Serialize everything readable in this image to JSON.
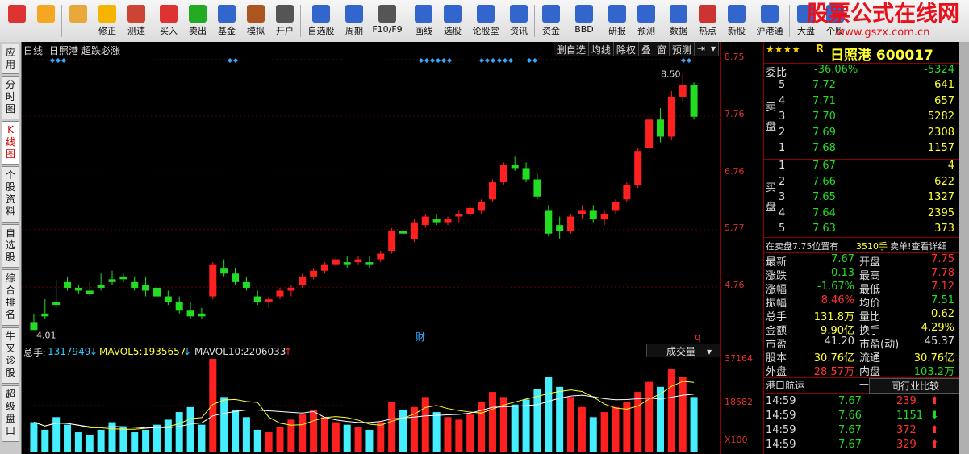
{
  "toolbar": {
    "buttons": [
      {
        "label": "",
        "icon": "menu-grid-icon"
      },
      {
        "label": "",
        "icon": "back-arrow-icon"
      },
      {
        "label": "",
        "icon": "up-down-icon"
      },
      {
        "label": "修正",
        "icon": "fix-icon"
      },
      {
        "label": "测速",
        "icon": "speed-icon"
      },
      {
        "label": "买入",
        "icon": "buy-icon"
      },
      {
        "label": "卖出",
        "icon": "sell-icon"
      },
      {
        "label": "基金",
        "icon": "fund-icon"
      },
      {
        "label": "模拟",
        "icon": "hammer-icon"
      },
      {
        "label": "开户",
        "icon": "lock-icon"
      },
      {
        "label": "自选股",
        "icon": "star-icon"
      },
      {
        "label": "周期",
        "icon": "clock-icon"
      },
      {
        "label": "F10/F9",
        "icon": "f10-icon"
      },
      {
        "label": "画线",
        "icon": "pen-icon"
      },
      {
        "label": "选股",
        "icon": "select-icon"
      },
      {
        "label": "论股堂",
        "icon": "forum-icon"
      },
      {
        "label": "资讯",
        "icon": "news-icon"
      },
      {
        "label": "资金",
        "icon": "money-icon"
      },
      {
        "label": "BBD",
        "icon": "bbd-icon"
      },
      {
        "label": "研报",
        "icon": "report-icon"
      },
      {
        "label": "预测",
        "icon": "forecast-icon"
      },
      {
        "label": "数据",
        "icon": "pe-icon"
      },
      {
        "label": "热点",
        "icon": "hot-icon"
      },
      {
        "label": "新股",
        "icon": "ipo-icon"
      },
      {
        "label": "沪港通",
        "icon": "hk-icon"
      },
      {
        "label": "大盘",
        "icon": "market-icon"
      },
      {
        "label": "个股",
        "icon": "stock-icon"
      }
    ],
    "brand_title": "股票公式在线网",
    "brand_url": "www.gszx.com.cn"
  },
  "sidetabs": [
    "应用",
    "分时图",
    "K线图",
    "个股资料",
    "自选股",
    "综合排名",
    "牛叉诊股",
    "超级盘口"
  ],
  "chart": {
    "period": "日线",
    "stock_name": "日照港",
    "indicator": "超跌必涨",
    "tools": [
      "删自选",
      "均线",
      "除权",
      "叠",
      "窗",
      "预测"
    ],
    "price_high_label": "8.50",
    "price_low_label": "4.01",
    "marker_cai": "财",
    "marker_q": "q",
    "price_scale": [
      "8.75",
      "7.76",
      "6.76",
      "5.77",
      "4.76"
    ],
    "vol_scale": [
      "37164",
      "18582",
      "X100"
    ],
    "vol_total_label": "总手:",
    "vol_total": "1317949",
    "mavol5_label": "MAVOL5:",
    "mavol5": "1935657",
    "mavol10_label": "MAVOL10:",
    "mavol10": "2206033",
    "vol_dropdown": "成交量"
  },
  "chart_data": {
    "type": "candlestick",
    "y_range": [
      4.0,
      8.75
    ],
    "candles": [
      [
        4.15,
        4.3,
        4.05,
        4.01
      ],
      [
        4.3,
        4.55,
        4.2,
        4.25
      ],
      [
        4.5,
        4.9,
        4.4,
        4.45
      ],
      [
        4.85,
        4.95,
        4.7,
        4.75
      ],
      [
        4.75,
        4.8,
        4.65,
        4.7
      ],
      [
        4.7,
        4.85,
        4.6,
        4.65
      ],
      [
        4.8,
        5.0,
        4.7,
        4.75
      ],
      [
        4.9,
        5.05,
        4.8,
        4.85
      ],
      [
        4.95,
        5.0,
        4.85,
        4.9
      ],
      [
        4.85,
        4.95,
        4.7,
        4.75
      ],
      [
        4.8,
        4.95,
        4.6,
        4.7
      ],
      [
        4.75,
        4.9,
        4.55,
        4.6
      ],
      [
        4.6,
        4.7,
        4.45,
        4.5
      ],
      [
        4.5,
        4.6,
        4.3,
        4.35
      ],
      [
        4.35,
        4.5,
        4.2,
        4.25
      ],
      [
        4.3,
        4.4,
        4.2,
        4.25
      ],
      [
        4.6,
        5.2,
        4.55,
        5.15
      ],
      [
        5.1,
        5.25,
        4.95,
        5.0
      ],
      [
        5.0,
        5.1,
        4.8,
        4.85
      ],
      [
        4.85,
        4.95,
        4.7,
        4.75
      ],
      [
        4.6,
        4.7,
        4.45,
        4.5
      ],
      [
        4.5,
        4.6,
        4.4,
        4.55
      ],
      [
        4.6,
        4.75,
        4.55,
        4.7
      ],
      [
        4.7,
        4.8,
        4.6,
        4.75
      ],
      [
        4.8,
        5.0,
        4.75,
        4.95
      ],
      [
        4.95,
        5.1,
        4.9,
        5.05
      ],
      [
        5.05,
        5.2,
        5.0,
        5.15
      ],
      [
        5.15,
        5.3,
        5.1,
        5.25
      ],
      [
        5.2,
        5.3,
        5.1,
        5.15
      ],
      [
        5.2,
        5.3,
        5.15,
        5.25
      ],
      [
        5.2,
        5.3,
        5.1,
        5.15
      ],
      [
        5.25,
        5.4,
        5.2,
        5.35
      ],
      [
        5.4,
        5.8,
        5.35,
        5.75
      ],
      [
        5.75,
        6.0,
        5.6,
        5.7
      ],
      [
        5.6,
        5.95,
        5.55,
        5.9
      ],
      [
        5.85,
        6.05,
        5.8,
        6.0
      ],
      [
        5.95,
        6.05,
        5.85,
        5.9
      ],
      [
        5.9,
        6.0,
        5.85,
        5.95
      ],
      [
        6.0,
        6.1,
        5.9,
        6.05
      ],
      [
        6.05,
        6.2,
        6.0,
        6.15
      ],
      [
        6.1,
        6.3,
        6.05,
        6.25
      ],
      [
        6.3,
        6.65,
        6.25,
        6.6
      ],
      [
        6.6,
        6.95,
        6.55,
        6.9
      ],
      [
        6.9,
        7.05,
        6.8,
        6.85
      ],
      [
        6.85,
        6.95,
        6.6,
        6.65
      ],
      [
        6.65,
        6.75,
        6.3,
        6.35
      ],
      [
        6.1,
        6.2,
        5.65,
        5.7
      ],
      [
        5.85,
        6.0,
        5.6,
        5.75
      ],
      [
        5.75,
        6.05,
        5.7,
        6.0
      ],
      [
        6.05,
        6.2,
        5.95,
        6.1
      ],
      [
        6.1,
        6.2,
        5.9,
        5.95
      ],
      [
        5.95,
        6.1,
        5.85,
        6.05
      ],
      [
        6.1,
        6.3,
        6.05,
        6.25
      ],
      [
        6.3,
        6.6,
        6.25,
        6.55
      ],
      [
        6.55,
        7.2,
        6.5,
        7.15
      ],
      [
        7.2,
        7.8,
        7.1,
        7.7
      ],
      [
        7.7,
        7.9,
        7.3,
        7.4
      ],
      [
        7.4,
        8.2,
        7.35,
        8.1
      ],
      [
        8.1,
        8.5,
        8.0,
        8.3
      ],
      [
        8.3,
        8.35,
        7.7,
        7.75
      ]
    ],
    "volume_range": [
      0,
      37164
    ],
    "volumes": [
      12000,
      9000,
      14000,
      11000,
      8000,
      7000,
      9000,
      12000,
      10000,
      8000,
      9000,
      11000,
      13000,
      16000,
      18000,
      11000,
      37164,
      22000,
      17000,
      14000,
      9000,
      8000,
      10000,
      13000,
      15000,
      17000,
      14000,
      12000,
      11000,
      10000,
      9000,
      12000,
      20000,
      17000,
      18000,
      22000,
      16000,
      14000,
      13000,
      15000,
      20000,
      24000,
      22000,
      19000,
      21000,
      25000,
      30000,
      26000,
      22000,
      18000,
      14000,
      16000,
      18000,
      20000,
      24000,
      28000,
      26000,
      33000,
      30000,
      22000
    ]
  },
  "panel": {
    "stars": "★★★★",
    "rating": "R",
    "stock_title": "日照港 600017",
    "webi_label": "委比",
    "webi_pct": "-36.06%",
    "webi_val": "-5324",
    "sell_label": "卖盘",
    "buy_label": "买盘",
    "sell": [
      [
        "5",
        "7.72",
        "641"
      ],
      [
        "4",
        "7.71",
        "657"
      ],
      [
        "3",
        "7.70",
        "5282"
      ],
      [
        "2",
        "7.69",
        "2308"
      ],
      [
        "1",
        "7.68",
        "1157"
      ]
    ],
    "buy": [
      [
        "1",
        "7.67",
        "4"
      ],
      [
        "2",
        "7.66",
        "622"
      ],
      [
        "3",
        "7.65",
        "1327"
      ],
      [
        "4",
        "7.64",
        "2395"
      ],
      [
        "5",
        "7.63",
        "373"
      ]
    ],
    "notice": "在卖盘7.75位置有",
    "notice_qty": "3510手",
    "notice_tail": "卖单!查看详细",
    "stats": [
      [
        "最新",
        "7.67",
        "开盘",
        "7.75"
      ],
      [
        "涨跌",
        "-0.13",
        "最高",
        "7.78"
      ],
      [
        "涨幅",
        "-1.67%",
        "最低",
        "7.12"
      ],
      [
        "振幅",
        "8.46%",
        "均价",
        "7.51"
      ],
      [
        "总手",
        "131.8万",
        "量比",
        "0.62"
      ],
      [
        "金额",
        "9.90亿",
        "换手",
        "4.29%"
      ],
      [
        "市盈",
        "41.20",
        "市盈(动)",
        "45.37"
      ],
      [
        "股本",
        "30.76亿",
        "流通",
        "30.76亿"
      ],
      [
        "外盘",
        "28.57万",
        "内盘",
        "103.2万"
      ]
    ],
    "industry": "港口航运",
    "industry_dash": "—",
    "industry_btn": "同行业比较",
    "ticks": [
      [
        "14:59",
        "7.67",
        "239"
      ],
      [
        "14:59",
        "7.66",
        "1151"
      ],
      [
        "14:59",
        "7.67",
        "372"
      ],
      [
        "14:59",
        "7.67",
        "329"
      ]
    ]
  }
}
